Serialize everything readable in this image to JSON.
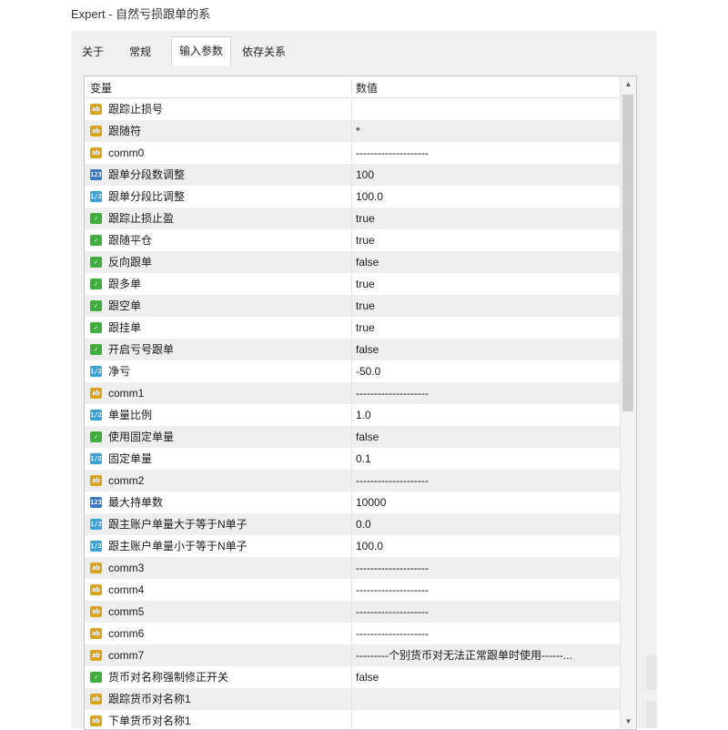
{
  "window": {
    "title": "Expert - 自然亏损跟单的系"
  },
  "tabs": [
    {
      "label": "关于"
    },
    {
      "label": "常规"
    },
    {
      "label": "输入参数"
    },
    {
      "label": "依存关系"
    }
  ],
  "grid": {
    "col_name": "变量",
    "col_value": "数值",
    "rows": [
      {
        "type": "ab",
        "name": "跟踪止损号",
        "value": ""
      },
      {
        "type": "ab",
        "name": "跟随符",
        "value": "*"
      },
      {
        "type": "ab",
        "name": "comm0",
        "value": "--------------------"
      },
      {
        "type": "int",
        "name": "跟单分段数调整",
        "value": "100"
      },
      {
        "type": "dbl",
        "name": "跟单分段比调整",
        "value": "100.0"
      },
      {
        "type": "bool",
        "name": "跟踪止损止盈",
        "value": "true"
      },
      {
        "type": "bool",
        "name": "跟随平仓",
        "value": "true"
      },
      {
        "type": "bool",
        "name": "反向跟单",
        "value": "false"
      },
      {
        "type": "bool",
        "name": "跟多单",
        "value": "true"
      },
      {
        "type": "bool",
        "name": "跟空单",
        "value": "true"
      },
      {
        "type": "bool",
        "name": "跟挂单",
        "value": "true"
      },
      {
        "type": "bool",
        "name": "开启亏号跟单",
        "value": "false"
      },
      {
        "type": "dbl",
        "name": "净亏",
        "value": "-50.0"
      },
      {
        "type": "ab",
        "name": "comm1",
        "value": "--------------------"
      },
      {
        "type": "dbl",
        "name": "单量比例",
        "value": "1.0"
      },
      {
        "type": "bool",
        "name": "使用固定单量",
        "value": "false"
      },
      {
        "type": "dbl",
        "name": "固定单量",
        "value": "0.1"
      },
      {
        "type": "ab",
        "name": "comm2",
        "value": "--------------------"
      },
      {
        "type": "int",
        "name": "最大持单数",
        "value": "10000"
      },
      {
        "type": "dbl",
        "name": "跟主账户单量大于等于N单子",
        "value": "0.0"
      },
      {
        "type": "dbl",
        "name": "跟主账户单量小于等于N单子",
        "value": "100.0"
      },
      {
        "type": "ab",
        "name": "comm3",
        "value": "--------------------"
      },
      {
        "type": "ab",
        "name": "comm4",
        "value": "--------------------"
      },
      {
        "type": "ab",
        "name": "comm5",
        "value": "--------------------"
      },
      {
        "type": "ab",
        "name": "comm6",
        "value": "--------------------"
      },
      {
        "type": "ab",
        "name": "comm7",
        "value": "---------个别货币对无法正常跟单时使用------..."
      },
      {
        "type": "bool",
        "name": "货币对名称强制修正开关",
        "value": "false"
      },
      {
        "type": "ab",
        "name": "跟踪货币对名称1",
        "value": ""
      },
      {
        "type": "ab",
        "name": "下单货币对名称1",
        "value": ""
      }
    ]
  },
  "icon_colors": {
    "ab": "#d9a520",
    "int": "#3a78c8",
    "dbl": "#3aa2d8",
    "bool": "#3fae3f"
  },
  "icon_glyphs": {
    "ab": "ab",
    "int": "123",
    "dbl": "1/2",
    "bool": "✓"
  }
}
